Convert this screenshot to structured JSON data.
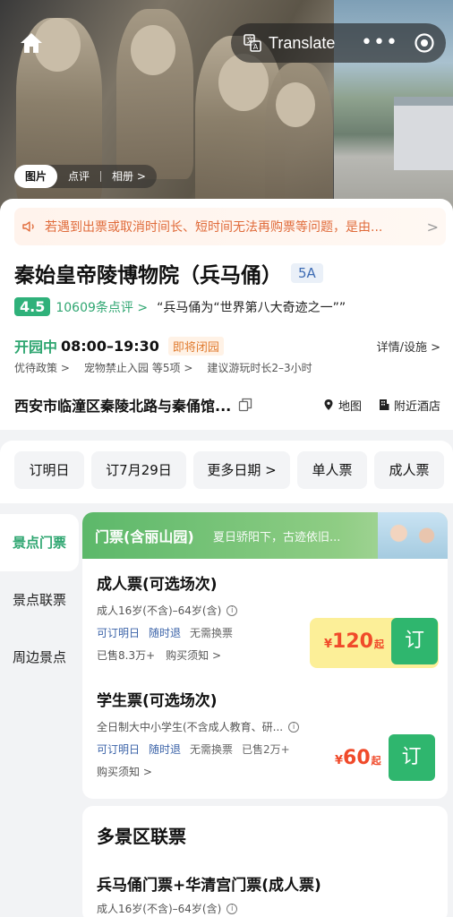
{
  "header": {
    "translate_label": "Translate",
    "more_label": "•••"
  },
  "media_tabs": [
    "图片",
    "点评",
    "相册 >"
  ],
  "notice": {
    "text": "若遇到出票或取消时间长、短时间无法再购票等问题，是由...",
    "chevron": ">"
  },
  "attraction": {
    "name": "秦始皇帝陵博物院（兵马俑）",
    "level": "5A",
    "score": "4.5",
    "reviews": "10609条点评 >",
    "quote": "“兵马俑为“世界第八大奇迹之一””",
    "open_status": "开园中",
    "open_hours": "08:00–19:30",
    "closing_tag": "即将闭园",
    "detail_link": "详情/设施 >",
    "policies": [
      "优待政策 >",
      "宠物禁止入园",
      "等5项 >",
      "建议游玩时长2–3小时"
    ],
    "address": "西安市临潼区秦陵北路与秦俑馆...",
    "map_label": "地图",
    "hotel_label": "附近酒店"
  },
  "date_chips": [
    "订明日",
    "订7月29日",
    "更多日期 >",
    "单人票",
    "成人票"
  ],
  "side_nav": [
    "景点门票",
    "景点联票",
    "周边景点"
  ],
  "ticket_panel": {
    "name": "门票(含丽山园)",
    "slogan": "夏日骄阳下，古迹依旧..."
  },
  "tickets": [
    {
      "name": "成人票(可选场次)",
      "desc": "成人16岁(不含)–64岁(含)",
      "tags": [
        "可订明日",
        "随时退",
        "无需换票"
      ],
      "sold": "已售8.3万+",
      "notice": "购买须知 >",
      "price_symbol": "¥",
      "price": "120",
      "price_suffix": "起",
      "book_label": "订"
    },
    {
      "name": "学生票(可选场次)",
      "desc": "全日制大中小学生(不含成人教育、研...",
      "tags": [
        "可订明日",
        "随时退",
        "无需换票"
      ],
      "sold": "已售2万+",
      "notice": "购买须知 >",
      "price_symbol": "¥",
      "price": "60",
      "price_suffix": "起",
      "book_label": "订"
    }
  ],
  "combo": {
    "title": "多景区联票",
    "item": "兵马俑门票+华清宫门票(成人票)",
    "desc": "成人16岁(不含)–64岁(含)"
  },
  "colors": {
    "accent_green": "#2fa671",
    "price_red": "#f04a2a",
    "link_blue": "#3b63a8",
    "notice_orange": "#e06b3a"
  }
}
